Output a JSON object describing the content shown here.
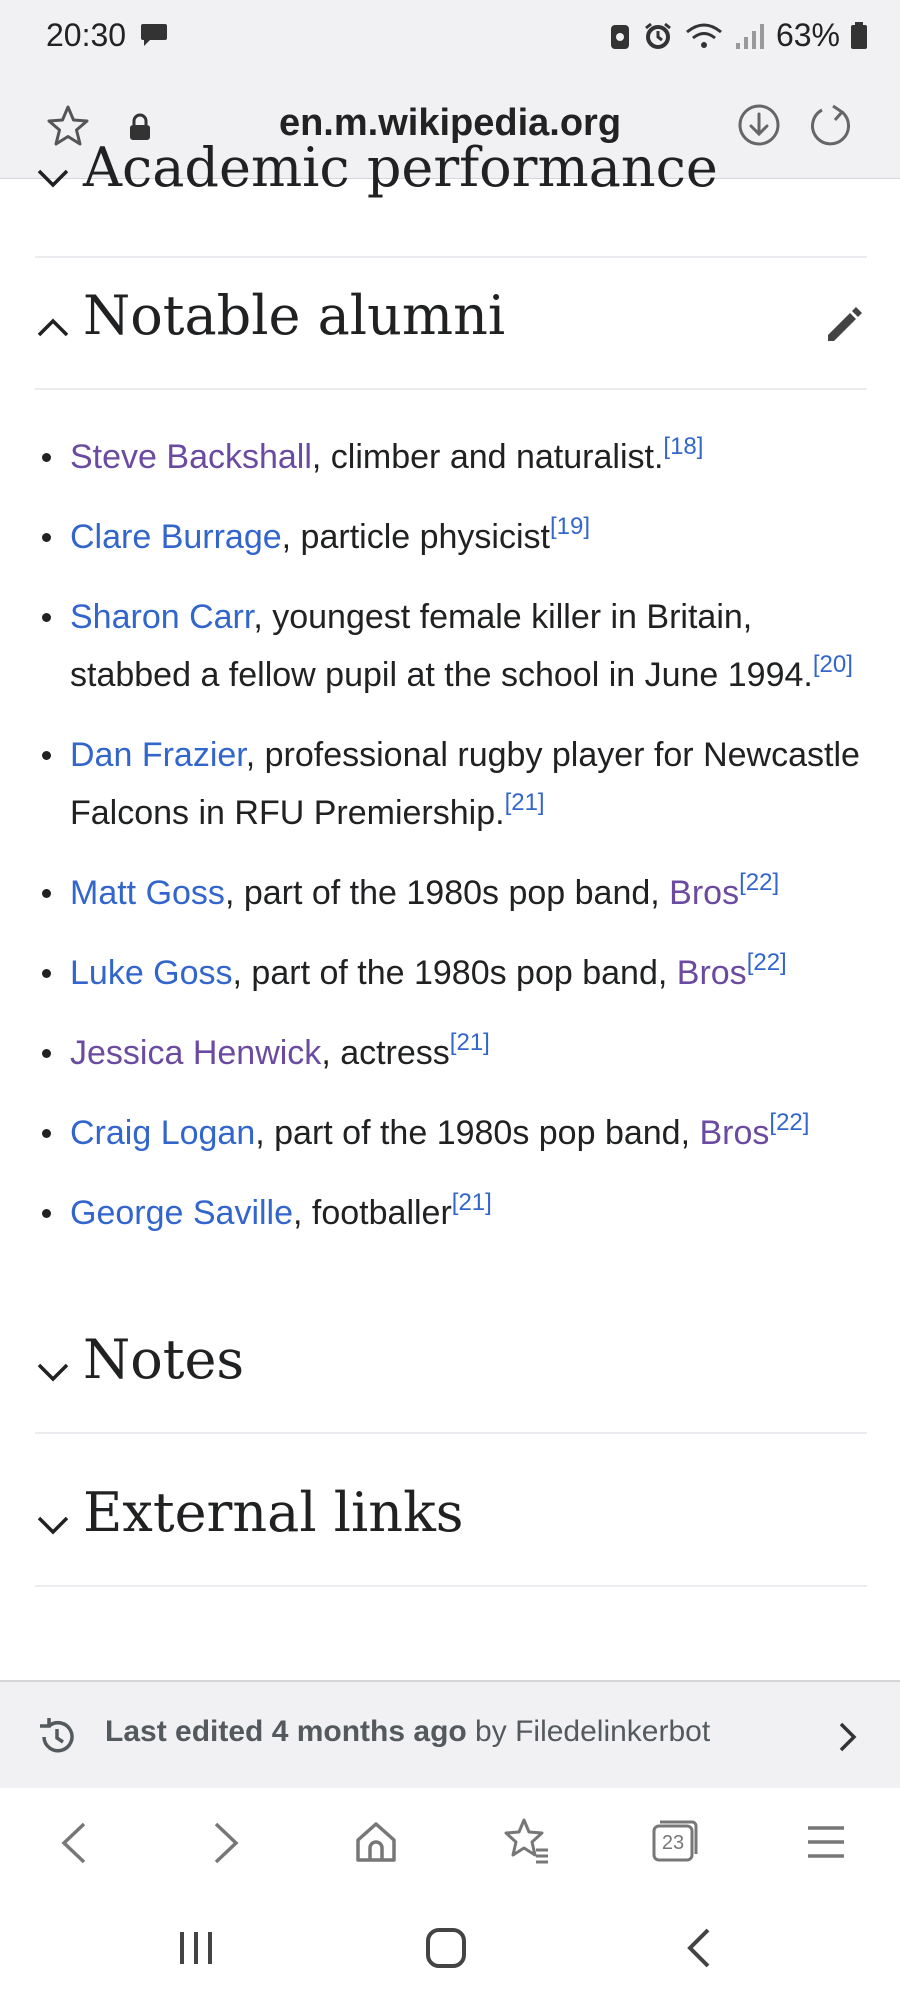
{
  "status_bar": {
    "time": "20:30",
    "battery": "63%"
  },
  "address_bar": {
    "url": "en.m.wikipedia.org"
  },
  "sections": {
    "academic": "Academic performance",
    "alumni": "Notable alumni",
    "notes": "Notes",
    "external": "External links"
  },
  "alumni": [
    {
      "name": "Steve Backshall",
      "text": ", climber and naturalist.",
      "ref": "[18]"
    },
    {
      "name": "Clare Burrage",
      "text": ", particle physicist",
      "ref": "[19]"
    },
    {
      "name": "Sharon Carr",
      "text": ", youngest female killer in Britain, stabbed a fellow pupil at the school in June 1994.",
      "ref": "[20]"
    },
    {
      "name": "Dan Frazier",
      "text": ", professional rugby player for Newcastle Falcons in RFU Premiership.",
      "ref": "[21]"
    },
    {
      "name": "Matt Goss",
      "text": ", part of the 1980s pop band, ",
      "link2": "Bros",
      "ref": "[22]"
    },
    {
      "name": "Luke Goss",
      "text": ", part of the 1980s pop band, ",
      "link2": "Bros",
      "ref": "[22]"
    },
    {
      "name": "Jessica Henwick",
      "text": ", actress",
      "ref": "[21]"
    },
    {
      "name": "Craig Logan",
      "text": ", part of the 1980s pop band, ",
      "link2": "Bros",
      "ref": "[22]"
    },
    {
      "name": "George Saville",
      "text": ", footballer",
      "ref": "[21]"
    }
  ],
  "footer": {
    "edited_label": "Last edited 4 months ago",
    "by": " by Filedelinkerbot"
  },
  "bottom_nav": {
    "tabs_count": "23"
  },
  "colors": {
    "link": "#3366cc",
    "visited": "#6b4ba1",
    "text": "#202122",
    "bar": "#f1f1f4"
  }
}
